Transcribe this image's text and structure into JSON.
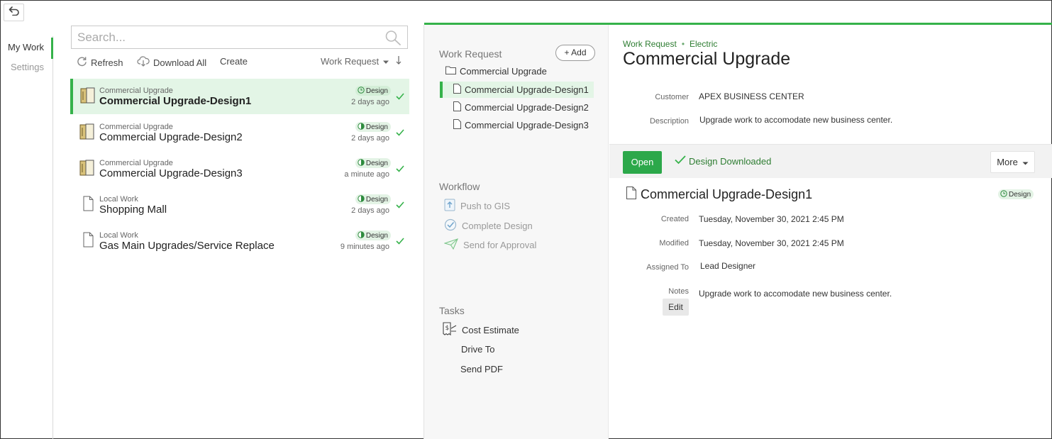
{
  "nav": {
    "back_icon": "undo-arrow-icon",
    "items": [
      {
        "label": "My Work",
        "active": true
      },
      {
        "label": "Settings",
        "active": false
      }
    ]
  },
  "search": {
    "placeholder": "Search...",
    "value": ""
  },
  "toolbar": {
    "refresh": "Refresh",
    "download_all": "Download All",
    "create": "Create",
    "filter": "Work Request"
  },
  "work_list": [
    {
      "parent": "Commercial Upgrade",
      "title": "Commercial Upgrade-Design1",
      "status": "Design",
      "time": "2 days ago",
      "icon": "folder-book-icon",
      "selected": true
    },
    {
      "parent": "Commercial Upgrade",
      "title": "Commercial Upgrade-Design2",
      "status": "Design",
      "time": "2 days ago",
      "icon": "folder-book-icon",
      "selected": false
    },
    {
      "parent": "Commercial Upgrade",
      "title": "Commercial Upgrade-Design3",
      "status": "Design",
      "time": "a minute ago",
      "icon": "folder-book-icon",
      "selected": false
    },
    {
      "parent": "Local Work",
      "title": "Shopping Mall",
      "status": "Design",
      "time": "2 days ago",
      "icon": "document-icon",
      "selected": false
    },
    {
      "parent": "Local Work",
      "title": "Gas Main Upgrades/Service Replace",
      "status": "Design",
      "time": "9 minutes ago",
      "icon": "document-icon",
      "selected": false
    }
  ],
  "middle": {
    "work_request_title": "Work Request",
    "add_label": "+ Add",
    "tree": {
      "root": "Commercial Upgrade",
      "children": [
        "Commercial Upgrade-Design1",
        "Commercial Upgrade-Design2",
        "Commercial Upgrade-Design3"
      ]
    },
    "workflow_title": "Workflow",
    "workflow": [
      "Push to GIS",
      "Complete Design",
      "Send for Approval"
    ],
    "tasks_title": "Tasks",
    "tasks": [
      "Cost Estimate",
      "Drive To",
      "Send PDF"
    ]
  },
  "detail": {
    "breadcrumb": [
      "Work Request",
      "Electric"
    ],
    "title": "Commercial Upgrade",
    "customer_label": "Customer",
    "customer": "APEX BUSINESS CENTER",
    "description_label": "Description",
    "description": "Upgrade work to accomodate new business center.",
    "open_label": "Open",
    "download_status": "Design Downloaded",
    "more_label": "More",
    "design": {
      "title": "Commercial Upgrade-Design1",
      "status": "Design",
      "created_label": "Created",
      "created": "Tuesday, November 30, 2021 2:45 PM",
      "modified_label": "Modified",
      "modified": "Tuesday, November 30, 2021 2:45 PM",
      "assigned_label": "Assigned To",
      "assigned": "Lead Designer",
      "notes_label": "Notes",
      "notes": "Upgrade work to accomodate new business center.",
      "edit_label": "Edit"
    }
  },
  "colors": {
    "accent": "#35b24a",
    "open_button": "#2ca84a",
    "selected_bg": "#e3f5e6",
    "link_green": "#2e7d32"
  }
}
